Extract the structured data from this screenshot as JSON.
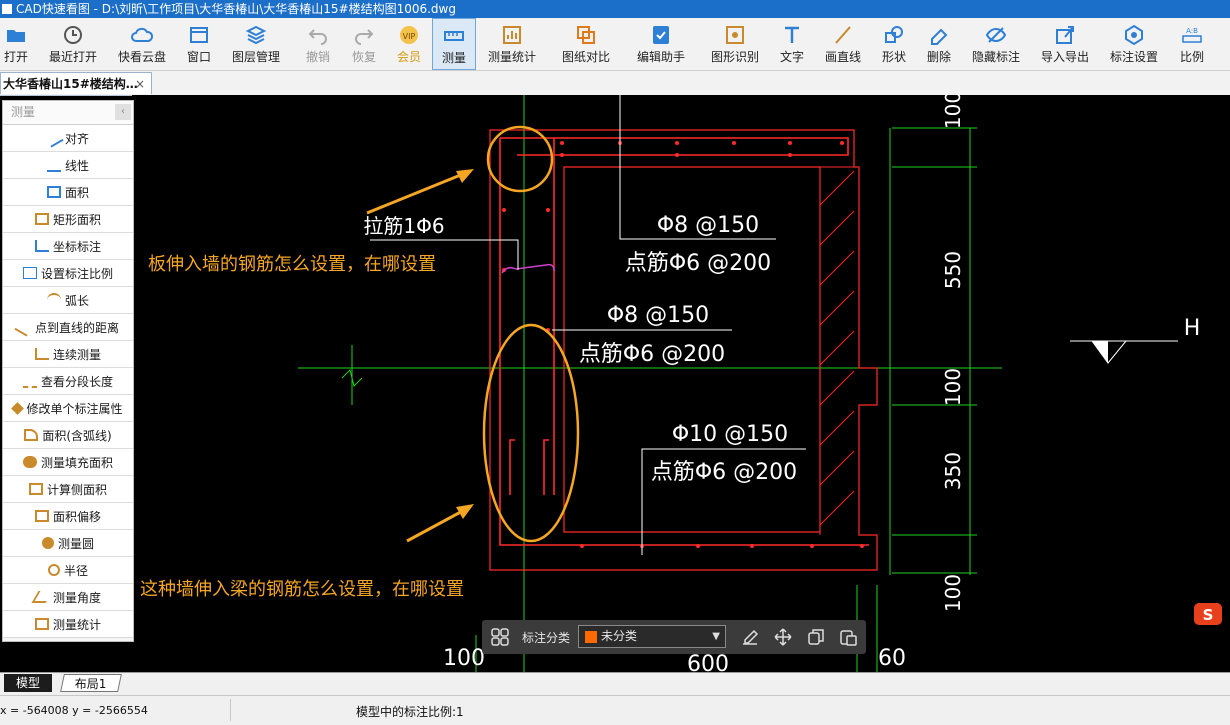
{
  "window": {
    "title": "CAD快速看图 - D:\\刘昕\\工作项目\\大华香椿山\\大华香椿山15#楼结构图1006.dwg"
  },
  "toolbar": {
    "buttons": [
      {
        "label": "打开"
      },
      {
        "label": "最近打开"
      },
      {
        "label": "快看云盘"
      },
      {
        "label": "窗口"
      },
      {
        "label": "图层管理"
      },
      {
        "label": "撤销"
      },
      {
        "label": "恢复"
      },
      {
        "label": "会员"
      },
      {
        "label": "测量"
      },
      {
        "label": "测量统计"
      },
      {
        "label": "图纸对比"
      },
      {
        "label": "编辑助手"
      },
      {
        "label": "图形识别"
      },
      {
        "label": "文字"
      },
      {
        "label": "画直线"
      },
      {
        "label": "形状"
      },
      {
        "label": "删除"
      },
      {
        "label": "隐藏标注"
      },
      {
        "label": "导入导出"
      },
      {
        "label": "标注设置"
      },
      {
        "label": "比例"
      }
    ]
  },
  "tabs": {
    "doc_tab": "大华香椿山15#楼结构…",
    "close": "×"
  },
  "measure_panel": {
    "title": "测量",
    "collapse": "‹",
    "items": [
      {
        "label": "对齐"
      },
      {
        "label": "线性"
      },
      {
        "label": "面积"
      },
      {
        "label": "矩形面积"
      },
      {
        "label": "坐标标注"
      },
      {
        "label": "设置标注比例"
      },
      {
        "label": "弧长"
      },
      {
        "label": "点到直线的距离"
      },
      {
        "label": "连续测量"
      },
      {
        "label": "查看分段长度"
      },
      {
        "label": "修改单个标注属性"
      },
      {
        "label": "面积(含弧线)"
      },
      {
        "label": "测量填充面积"
      },
      {
        "label": "计算侧面积"
      },
      {
        "label": "面积偏移"
      },
      {
        "label": "测量圆"
      },
      {
        "label": "半径"
      },
      {
        "label": "测量角度"
      },
      {
        "label": "测量统计"
      }
    ]
  },
  "drawing": {
    "rebar_labels": [
      "Φ8 @150",
      "点筋Φ6 @200",
      "Φ8 @150",
      "点筋Φ6 @200",
      "Φ10 @150",
      "点筋Φ6 @200"
    ],
    "tie_label": "拉筋1Φ6",
    "dims_right": [
      "100",
      "550",
      "100",
      "350",
      "100"
    ],
    "dims_bottom": [
      "100",
      "600",
      "60"
    ],
    "level_mark": "H",
    "question1": "板伸入墙的钢筋怎么设置，在哪设置",
    "question2": "这种墙伸入梁的钢筋怎么设置，在哪设置",
    "colors": {
      "annotation": "#f5a623",
      "rebar": "#ff2a2a",
      "dim": "#1fd11f",
      "text": "#ffffff"
    }
  },
  "annotation_bar": {
    "label": "标注分类",
    "category": "未分类",
    "category_color": "#ff6a00"
  },
  "layout_tabs": {
    "model": "模型",
    "layout1": "布局1"
  },
  "status": {
    "coords": "x = -564008  y = -2566554",
    "scale_text": "模型中的标注比例:1"
  }
}
